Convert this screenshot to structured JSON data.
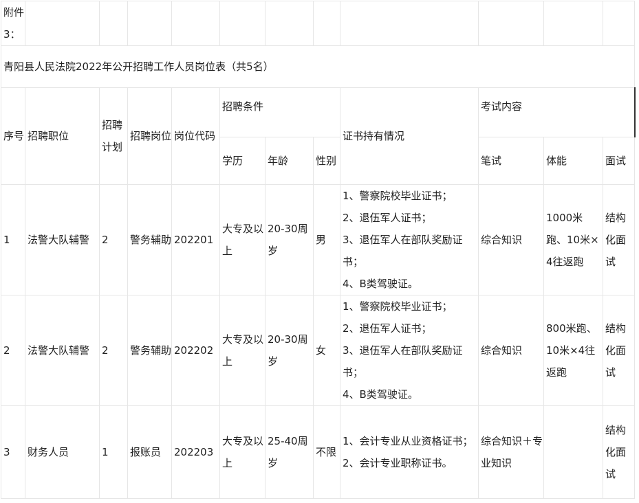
{
  "attachment_label": "附件3：",
  "table_title": "青阳县人民法院2022年公开招聘工作人员岗位表（共5名）",
  "headers": {
    "seq": "序号",
    "position": "招聘职位",
    "plan": "招聘计划",
    "post": "招聘岗位",
    "code": "岗位代码",
    "conditions": "招聘条件",
    "education": "学历",
    "age": "年龄",
    "gender": "性别",
    "certificates": "证书持有情况",
    "exam": "考试内容",
    "written": "笔试",
    "physical": "体能",
    "interview": "面试"
  },
  "rows": [
    {
      "seq": "1",
      "position": "法警大队辅警",
      "plan": "2",
      "post": "警务辅助",
      "code": "202201",
      "education": "大专及以上",
      "age": "20-30周岁",
      "gender": "男",
      "certificates": [
        "1、警察院校毕业证书；",
        "2、退伍军人证书；",
        "3、退伍军人在部队奖励证书；",
        "4、B类驾驶证。"
      ],
      "written": "综合知识",
      "physical": "1000米跑、10米×4往返跑",
      "interview": "结构化面试"
    },
    {
      "seq": "2",
      "position": "法警大队辅警",
      "plan": "2",
      "post": "警务辅助",
      "code": "202202",
      "education": "大专及以上",
      "age": "20-30周岁",
      "gender": "女",
      "certificates": [
        "1、警察院校毕业证书；",
        "2、退伍军人证书；",
        "3、退伍军人在部队奖励证书；",
        "4、B类驾驶证。"
      ],
      "written": "综合知识",
      "physical": "800米跑、10米×4往返跑",
      "interview": "结构化面试"
    },
    {
      "seq": "3",
      "position": "财务人员",
      "plan": "1",
      "post": "报账员",
      "code": "202203",
      "education": "大专及以上",
      "age": "25-40周岁",
      "gender": "不限",
      "certificates": [
        "1、会计专业从业资格证书；",
        "2、会计专业职称证书。"
      ],
      "written": "综合知识＋专业知识",
      "physical": "",
      "interview": "结构化面试"
    }
  ]
}
